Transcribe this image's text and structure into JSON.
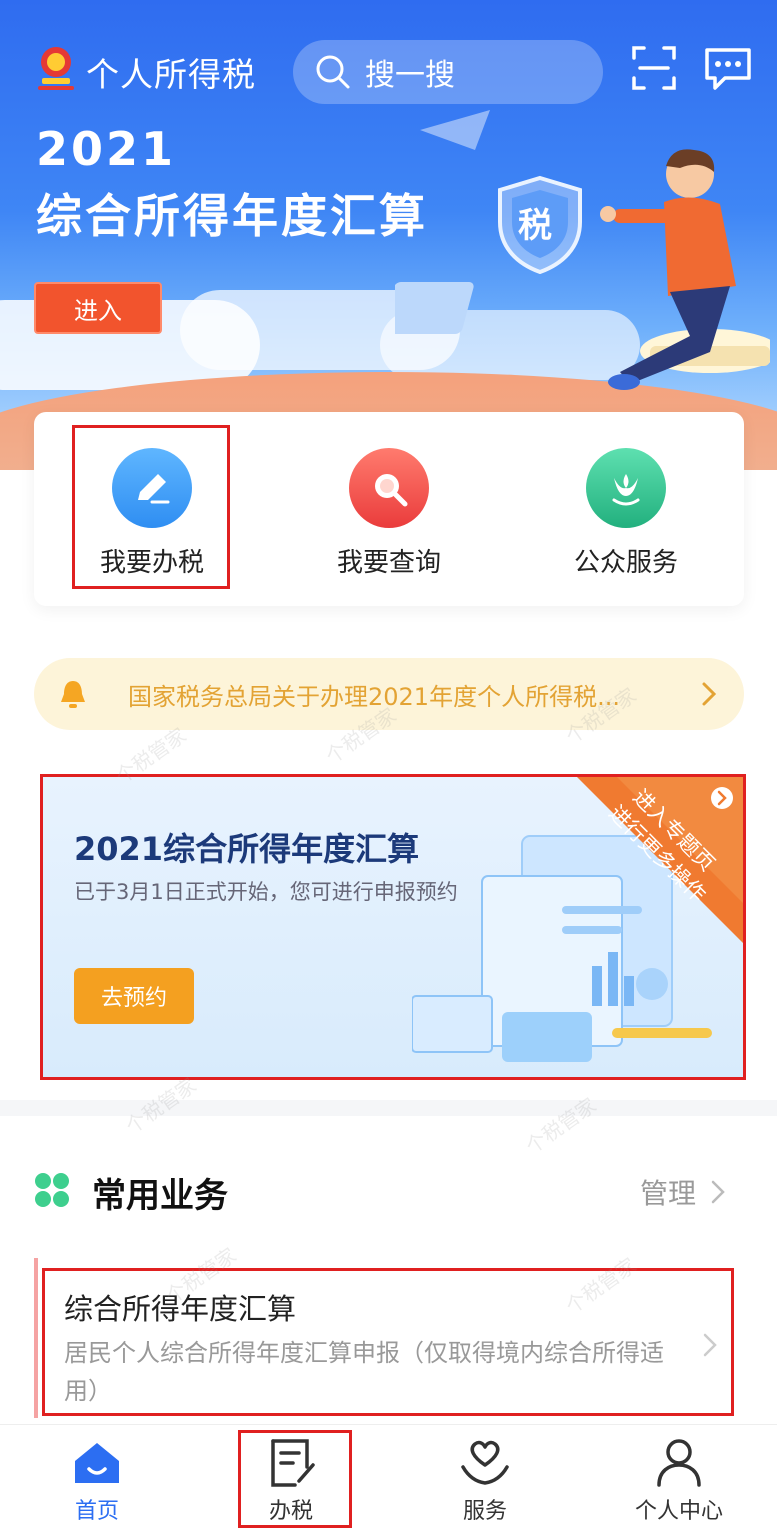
{
  "header": {
    "app_title": "个人所得税",
    "search_placeholder": "搜一搜"
  },
  "hero": {
    "year": "2021",
    "headline": "综合所得年度汇算",
    "enter_label": "进入",
    "shield_char": "税"
  },
  "quick_actions": [
    {
      "label": "我要办税",
      "icon": "pencil-icon",
      "color": "#3a9bf5"
    },
    {
      "label": "我要查询",
      "icon": "magnifier-icon",
      "color": "#f0524a"
    },
    {
      "label": "公众服务",
      "icon": "tulip-icon",
      "color": "#35c494"
    }
  ],
  "notice": {
    "text": "国家税务总局关于办理2021年度个人所得税..."
  },
  "promo": {
    "title": "2021综合所得年度汇算",
    "description": "已于3月1日正式开始，您可进行申报预约",
    "button_label": "去预约",
    "ribbon_line1": "进入专题页",
    "ribbon_line2": "进行更多操作"
  },
  "common_business": {
    "title": "常用业务",
    "manage_label": "管理",
    "items": [
      {
        "title": "综合所得年度汇算",
        "description": "居民个人综合所得年度汇算申报（仅取得境内综合所得适用）"
      }
    ]
  },
  "bottom_nav": [
    {
      "label": "首页",
      "icon": "home-icon",
      "active": true
    },
    {
      "label": "办税",
      "icon": "tax-edit-icon",
      "active": false
    },
    {
      "label": "服务",
      "icon": "heart-hands-icon",
      "active": false
    },
    {
      "label": "个人中心",
      "icon": "person-icon",
      "active": false
    }
  ],
  "watermark": "个税管家",
  "colors": {
    "primary": "#2c6ef2",
    "highlight_box": "#e02020",
    "notice_text": "#e3a334",
    "promo_button": "#f4a020",
    "ribbon": "#f07a30"
  }
}
